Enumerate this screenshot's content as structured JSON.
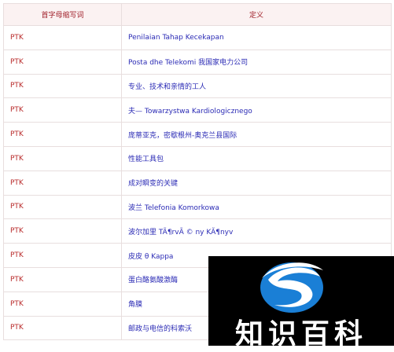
{
  "table": {
    "headers": {
      "abbr": "首字母缩写词",
      "definition": "定义"
    },
    "rows": [
      {
        "abbr": "PTK",
        "definition": "Penilaian Tahap Kecekapan"
      },
      {
        "abbr": "PTK",
        "definition": "Posta dhe Telekomi 我国家电力公司"
      },
      {
        "abbr": "PTK",
        "definition": "专业、技术和亲情的工人"
      },
      {
        "abbr": "PTK",
        "definition": "夫— Towarzystwa Kardiologicznego"
      },
      {
        "abbr": "PTK",
        "definition": "庞蒂亚克，密歇根州-奥克兰县国际"
      },
      {
        "abbr": "PTK",
        "definition": "性能工具包"
      },
      {
        "abbr": "PTK",
        "definition": "成对瞬变的关键"
      },
      {
        "abbr": "PTK",
        "definition": "波兰 Telefonia Komorkowa"
      },
      {
        "abbr": "PTK",
        "definition": "波尔加里 TÃ¶rvÃ © ny KÃ¶nyv"
      },
      {
        "abbr": "PTK",
        "definition": "皮皮 θ Kappa"
      },
      {
        "abbr": "PTK",
        "definition": "蛋白酪氨酸激酶"
      },
      {
        "abbr": "PTK",
        "definition": "角膜"
      },
      {
        "abbr": "PTK",
        "definition": "邮政与电信的科索沃"
      }
    ]
  },
  "watermark": {
    "text": "知识百科",
    "logo_icon": "s-swoosh-logo-icon",
    "logo_color": "#1a7fd6"
  }
}
